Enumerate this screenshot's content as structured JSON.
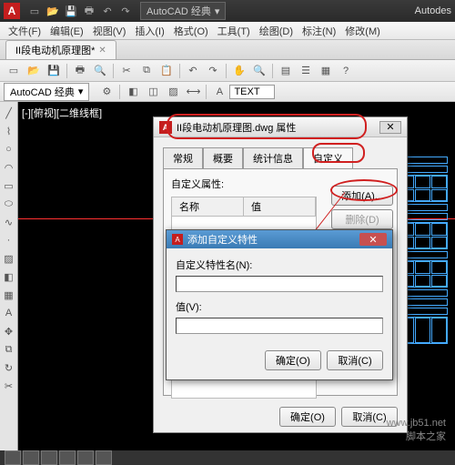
{
  "app": {
    "brand_letter": "A",
    "title_suffix": "Autodes",
    "workspace_combo": "AutoCAD 经典"
  },
  "menu": {
    "file": "文件(F)",
    "edit": "编辑(E)",
    "view": "视图(V)",
    "insert": "插入(I)",
    "format": "格式(O)",
    "tools": "工具(T)",
    "draw": "绘图(D)",
    "dimension": "标注(N)",
    "modify": "修改(M)"
  },
  "doc_tab": {
    "name": "II段电动机原理图*"
  },
  "toolbar2": {
    "workspace": "AutoCAD 经典",
    "textcmd": "TEXT"
  },
  "view_label": "[-][俯视][二维线框]",
  "dialog": {
    "title": "II段电动机原理图.dwg 属性",
    "tabs": {
      "general": "常规",
      "summary": "概要",
      "stats": "统计信息",
      "custom": "自定义"
    },
    "custom_label": "自定义属性:",
    "cols": {
      "name": "名称",
      "value": "值"
    },
    "add": "添加(A)...",
    "delete": "删除(D)",
    "ok": "确定(O)",
    "cancel": "取消(C)"
  },
  "subdialog": {
    "title": "添加自定义特性",
    "name_label": "自定义特性名(N):",
    "value_label": "值(V):",
    "name_value": "",
    "value_value": "",
    "ok": "确定(O)",
    "cancel": "取消(C)"
  },
  "watermark_site": "www.jb51.net",
  "watermark_cn": "脚本之家"
}
